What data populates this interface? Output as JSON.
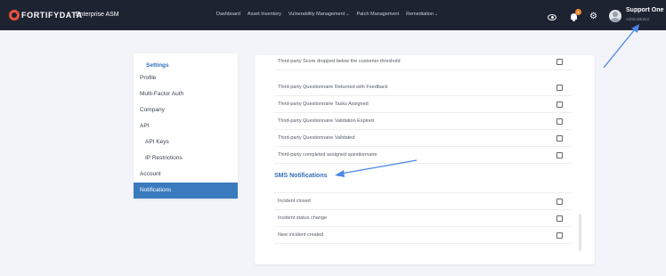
{
  "header": {
    "logo_text": "FORTIFYDATA",
    "app_name": "Enterprise ASM",
    "nav": [
      {
        "label": "Dashboard",
        "dropdown": false
      },
      {
        "label": "Asset Inventory",
        "dropdown": false
      },
      {
        "label": "Vulnerability Management",
        "dropdown": true
      },
      {
        "label": "Patch Management",
        "dropdown": false
      },
      {
        "label": "Remediation",
        "dropdown": true
      }
    ],
    "notification_count": "1",
    "user_name": "Support One",
    "user_role": "Administrator",
    "icons": [
      "eye-icon",
      "bell-icon",
      "gear-icon",
      "avatar"
    ]
  },
  "sidebar": {
    "heading": "Settings",
    "items": [
      {
        "label": "Profile"
      },
      {
        "label": "Multi-Factor Auth"
      },
      {
        "label": "Company"
      },
      {
        "label": "API"
      },
      {
        "label": "API Keys"
      },
      {
        "label": "IP Restrictions"
      },
      {
        "label": "Account"
      },
      {
        "label": "Notifications",
        "active": true
      }
    ]
  },
  "email_notifications": [
    {
      "label": "Third-party Score dropped below the customer threshold",
      "checked": false
    },
    {
      "label": "Third-party Questionnaire Returned with Feedback",
      "checked": false
    },
    {
      "label": "Third-party Questionnaire Tasks Assigned",
      "checked": false
    },
    {
      "label": "Third-party Questionnaire Validation Expired",
      "checked": false
    },
    {
      "label": "Third-party Questionnaire Validated",
      "checked": false
    },
    {
      "label": "Third-party completed assigned questionnaire",
      "checked": false
    }
  ],
  "sms": {
    "title": "SMS Notifications",
    "items": [
      {
        "label": "Incident closed",
        "checked": false
      },
      {
        "label": "Incident status change",
        "checked": false
      },
      {
        "label": "New incident created",
        "checked": false
      }
    ]
  },
  "colors": {
    "topbar": "#1e2332",
    "accent": "#2f6fb8",
    "active_item": "#3a7abf",
    "badge": "#f28b32",
    "annotation_arrow": "#4a86e8"
  }
}
